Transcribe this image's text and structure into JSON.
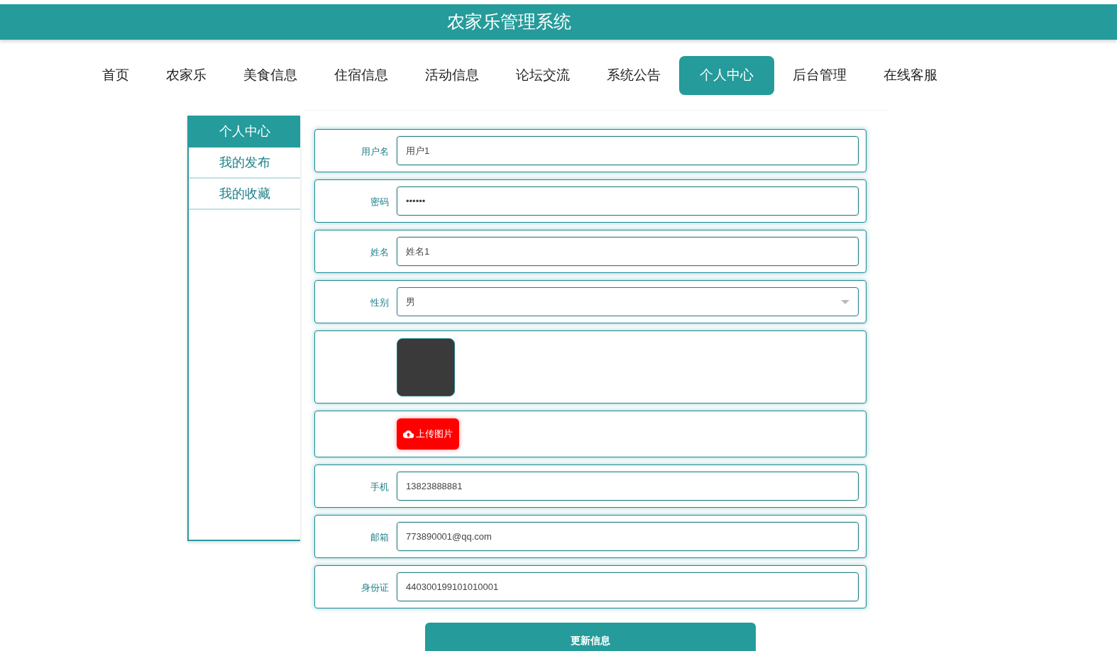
{
  "header": {
    "title": "农家乐管理系统"
  },
  "nav": [
    {
      "label": "首页",
      "selected": false
    },
    {
      "label": "农家乐",
      "selected": false
    },
    {
      "label": "美食信息",
      "selected": false
    },
    {
      "label": "住宿信息",
      "selected": false
    },
    {
      "label": "活动信息",
      "selected": false
    },
    {
      "label": "论坛交流",
      "selected": false
    },
    {
      "label": "系统公告",
      "selected": false
    },
    {
      "label": "个人中心",
      "selected": true
    },
    {
      "label": "后台管理",
      "selected": false
    },
    {
      "label": "在线客服",
      "selected": false
    }
  ],
  "sidebar": {
    "title": "个人中心",
    "items": [
      {
        "label": "我的发布"
      },
      {
        "label": "我的收藏"
      }
    ]
  },
  "form": {
    "rows": [
      {
        "kind": "text",
        "label": "用户名",
        "value": "用户1"
      },
      {
        "kind": "text",
        "label": "密码",
        "value": "••••••"
      },
      {
        "kind": "text",
        "label": "姓名",
        "value": "姓名1"
      },
      {
        "kind": "select",
        "label": "性别",
        "value": "男"
      },
      {
        "kind": "image"
      },
      {
        "kind": "upload",
        "button": "上传图片"
      },
      {
        "kind": "text",
        "label": "手机",
        "value": "13823888881"
      },
      {
        "kind": "text",
        "label": "邮箱",
        "value": "773890001@qq.com"
      },
      {
        "kind": "text",
        "label": "身份证",
        "value": "440300199101010001"
      }
    ],
    "submit": "更新信息"
  }
}
